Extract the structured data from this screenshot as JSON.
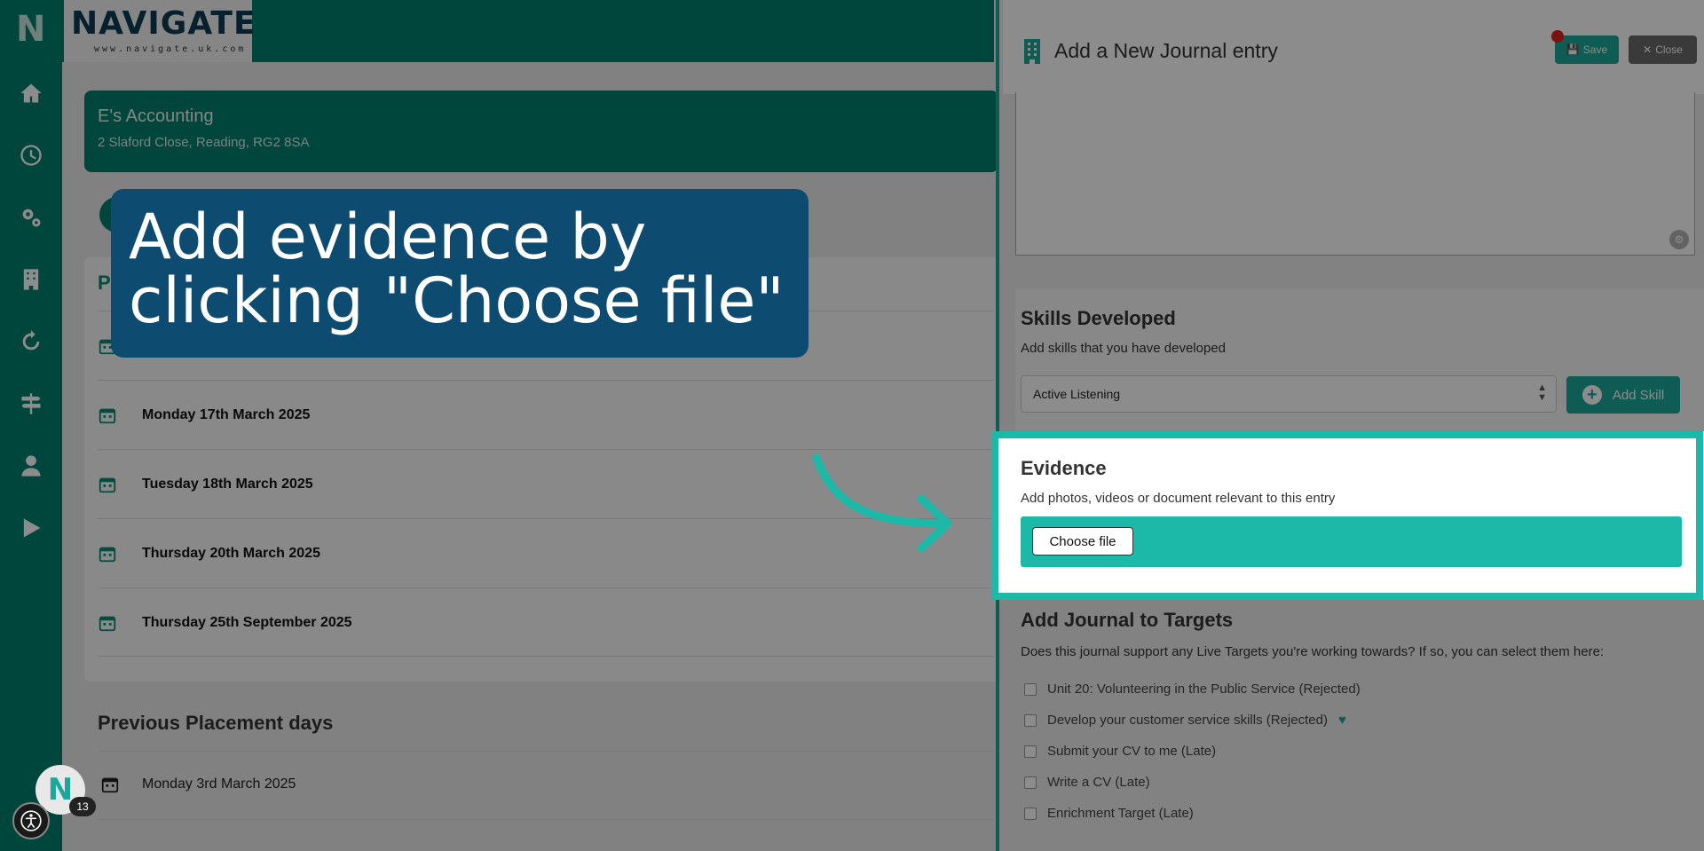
{
  "colors": {
    "brand": "#00806f",
    "accent": "#1aa89a",
    "highlight": "#1cb8a8",
    "callout": "#0d4b70"
  },
  "sidebar": {
    "brand_letter": "N",
    "icons": [
      "home-icon",
      "clock-icon",
      "gears-icon",
      "building-icon",
      "refresh-icon",
      "signpost-icon",
      "user-icon",
      "play-icon"
    ]
  },
  "header": {
    "logo_text": "NAVIGATE",
    "logo_url": "www.navigate.uk.com"
  },
  "company": {
    "name": "E's Accounting",
    "address": "2 Slaford Close, Reading, RG2 8SA"
  },
  "placement_days": {
    "section_initial": "P",
    "days": [
      {
        "label": ""
      },
      {
        "label": "Monday 17th March 2025"
      },
      {
        "label": "Tuesday 18th March 2025"
      },
      {
        "label": "Thursday 20th March 2025"
      },
      {
        "label": "Thursday 25th September 2025"
      }
    ]
  },
  "previous": {
    "title": "Previous Placement days",
    "days": [
      {
        "label": "Monday 3rd March 2025"
      }
    ]
  },
  "callout": {
    "line1": "Add evidence by",
    "line2": "clicking \"Choose file\""
  },
  "journal_panel": {
    "title": "Add a New Journal entry",
    "save_label": "Save",
    "close_label": "Close",
    "skills": {
      "title": "Skills Developed",
      "subtitle": "Add skills that you have developed",
      "selected": "Active Listening",
      "add_label": "Add Skill"
    },
    "evidence": {
      "title": "Evidence",
      "subtitle": "Add photos, videos or document relevant to this entry",
      "choose_label": "Choose file"
    },
    "targets": {
      "title": "Add Journal to Targets",
      "subtitle": "Does this journal support any Live Targets you're working towards? If so, you can select them here:",
      "items": [
        {
          "label": "Unit 20: Volunteering in the Public Service (Rejected)"
        },
        {
          "label": "Develop your customer service skills (Rejected)"
        },
        {
          "label": "Submit your CV to me (Late)"
        },
        {
          "label": "Write a CV (Late)"
        },
        {
          "label": "Enrichment Target (Late)"
        }
      ]
    }
  },
  "widgets": {
    "avatar_letter": "N",
    "notification_count": "13"
  }
}
